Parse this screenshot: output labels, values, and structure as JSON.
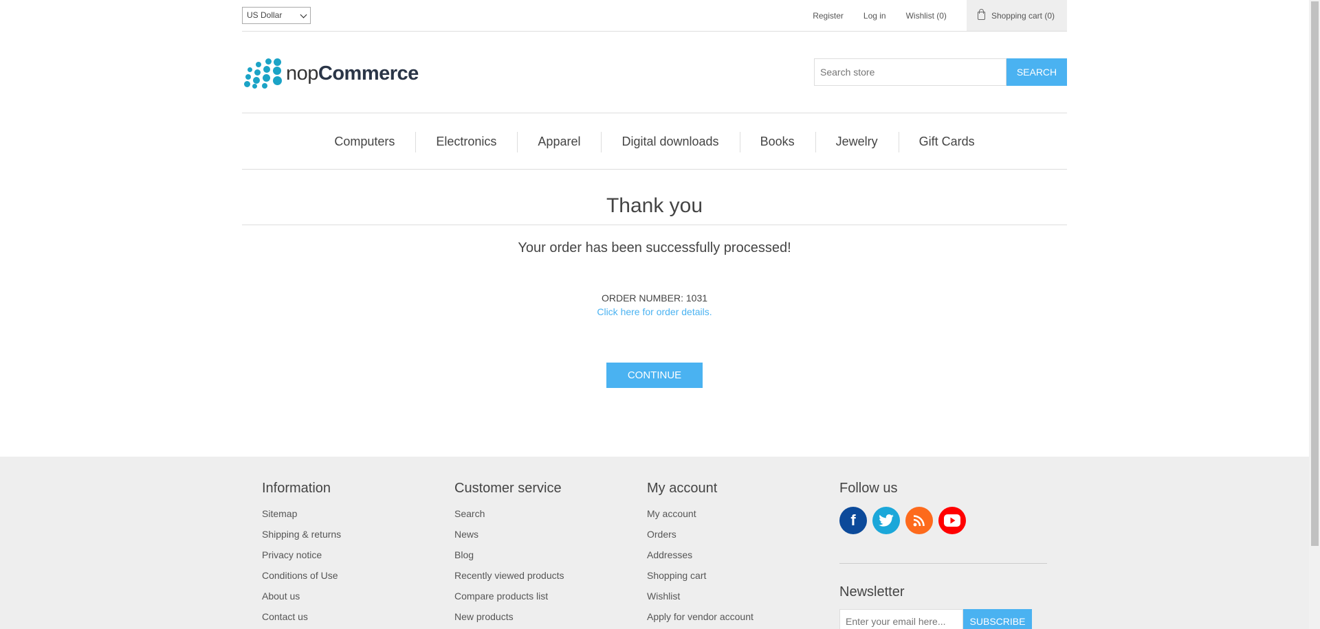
{
  "header": {
    "currency": "US Dollar",
    "links": {
      "register": "Register",
      "login": "Log in",
      "wishlist": "Wishlist (0)",
      "cart": "Shopping cart (0)"
    }
  },
  "logo": {
    "part1": "nop",
    "part2": "Commerce"
  },
  "search": {
    "placeholder": "Search store",
    "button": "SEARCH"
  },
  "menu": [
    "Computers",
    "Electronics",
    "Apparel",
    "Digital downloads",
    "Books",
    "Jewelry",
    "Gift Cards"
  ],
  "main": {
    "title": "Thank you",
    "success": "Your order has been successfully processed!",
    "order_number": "ORDER NUMBER: 1031",
    "details_link": "Click here for order details.",
    "continue": "CONTINUE"
  },
  "footer": {
    "information": {
      "title": "Information",
      "items": [
        "Sitemap",
        "Shipping & returns",
        "Privacy notice",
        "Conditions of Use",
        "About us",
        "Contact us"
      ]
    },
    "customer_service": {
      "title": "Customer service",
      "items": [
        "Search",
        "News",
        "Blog",
        "Recently viewed products",
        "Compare products list",
        "New products"
      ]
    },
    "my_account": {
      "title": "My account",
      "items": [
        "My account",
        "Orders",
        "Addresses",
        "Shopping cart",
        "Wishlist",
        "Apply for vendor account"
      ]
    },
    "follow_us": {
      "title": "Follow us",
      "icons": [
        "facebook-icon",
        "twitter-icon",
        "rss-icon",
        "youtube-icon"
      ],
      "facebook_letter": "f"
    },
    "newsletter": {
      "title": "Newsletter",
      "placeholder": "Enter your email here...",
      "button": "SUBSCRIBE"
    }
  },
  "colors": {
    "accent": "#4ab2f1",
    "logo": "#1ba3c6"
  }
}
